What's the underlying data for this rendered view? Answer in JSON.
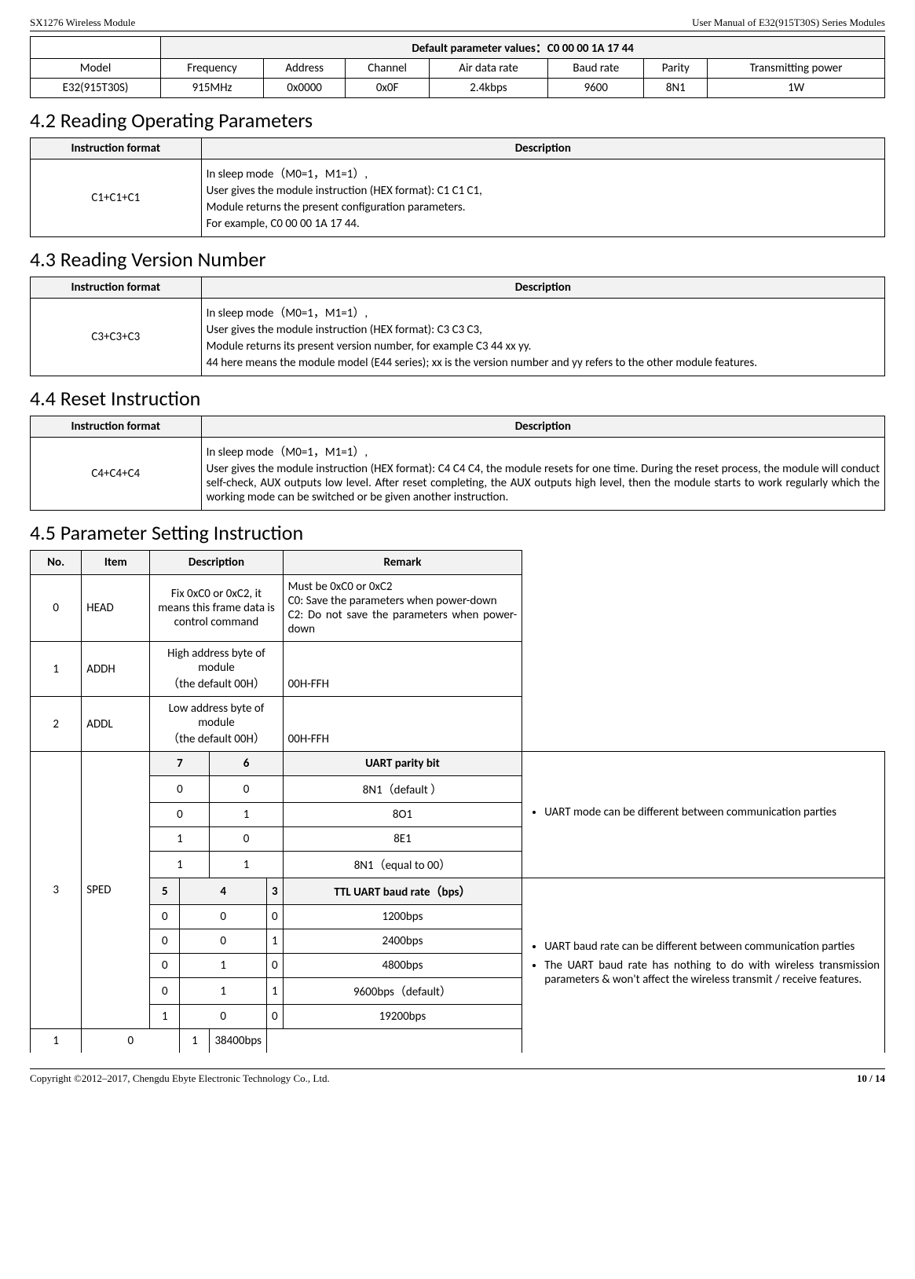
{
  "header": {
    "left": "SX1276 Wireless Module",
    "right": "User Manual of E32(915T30S) Series Modules"
  },
  "t1": {
    "title": "Default parameter values：C0 00 00 1A 17 44",
    "h": [
      "Model",
      "Frequency",
      "Address",
      "Channel",
      "Air data rate",
      "Baud rate",
      "Parity",
      "Transmitting power"
    ],
    "r": [
      "E32(915T30S)",
      "915MHz",
      "0x0000",
      "0x0F",
      "2.4kbps",
      "9600",
      "8N1",
      "1W"
    ]
  },
  "s42": {
    "title": "4.2 Reading Operating Parameters",
    "h": [
      "Instruction format",
      "Description"
    ],
    "fmt": "C1+C1+C1",
    "desc": [
      "In sleep mode（M0=1，M1=1）,",
      "User gives the module instruction (HEX format): C1 C1 C1,",
      "Module returns the present configuration parameters.",
      "For example, C0 00 00 1A 17 44."
    ]
  },
  "s43": {
    "title": "4.3 Reading Version Number",
    "h": [
      "Instruction format",
      "Description"
    ],
    "fmt": "C3+C3+C3",
    "desc": [
      "In sleep mode（M0=1，M1=1）,",
      "User gives the module instruction (HEX format): C3 C3 C3,",
      "Module returns its present version number, for example C3 44 xx yy.",
      "44 here means the module model (E44 series); xx is the version number and yy refers to the other module features."
    ]
  },
  "s44": {
    "title": "4.4 Reset Instruction",
    "h": [
      "Instruction format",
      "Description"
    ],
    "fmt": "C4+C4+C4",
    "desc": [
      "In sleep mode（M0=1，M1=1）,",
      "User gives the module instruction (HEX format): C4 C4 C4, the module resets for one time. During the reset process, the module will conduct self-check, AUX outputs low level. After reset completing, the AUX outputs high level, then the module starts to work regularly which the working mode can be switched or be given another instruction."
    ]
  },
  "s45": {
    "title": "4.5 Parameter Setting Instruction",
    "h": [
      "No.",
      "Item",
      "Description",
      "Remark"
    ],
    "rows": [
      {
        "no": "0",
        "item": "HEAD",
        "desc": "Fix 0xC0 or 0xC2, it means this frame data is control command",
        "remark": "Must be 0xC0 or 0xC2\nC0: Save the parameters when power-down\nC2: Do not save the parameters when power-down"
      },
      {
        "no": "1",
        "item": "ADDH",
        "desc": "High address byte of module\n（the default 00H）",
        "remark": "00H-FFH"
      },
      {
        "no": "2",
        "item": "ADDL",
        "desc": "Low address byte of module\n（the default 00H）",
        "remark": "00H-FFH"
      }
    ],
    "row3": {
      "no": "3",
      "item": "SPED",
      "parity": {
        "h": [
          "7",
          "6",
          "UART parity bit"
        ],
        "r": [
          [
            "0",
            "0",
            "8N1（default ）"
          ],
          [
            "0",
            "1",
            "8O1"
          ],
          [
            "1",
            "0",
            "8E1"
          ],
          [
            "1",
            "1",
            "8N1（equal to 00）"
          ]
        ],
        "remark": "UART mode can be different between communication parties"
      },
      "baud": {
        "h": [
          "5",
          "4",
          "3",
          "TTL UART baud rate（bps）"
        ],
        "r": [
          [
            "0",
            "0",
            "0",
            "1200bps"
          ],
          [
            "0",
            "0",
            "1",
            "2400bps"
          ],
          [
            "0",
            "1",
            "0",
            "4800bps"
          ],
          [
            "0",
            "1",
            "1",
            "9600bps（default）"
          ],
          [
            "1",
            "0",
            "0",
            "19200bps"
          ],
          [
            "1",
            "0",
            "1",
            "38400bps"
          ]
        ],
        "remark": [
          "UART baud rate can be different between communication parties",
          "The UART baud rate has nothing to do with wireless transmission parameters & won't affect the wireless transmit / receive features."
        ]
      }
    }
  },
  "footer": {
    "left": "Copyright ©2012–2017, Chengdu Ebyte Electronic Technology Co., Ltd.",
    "right": "10 / 14"
  }
}
